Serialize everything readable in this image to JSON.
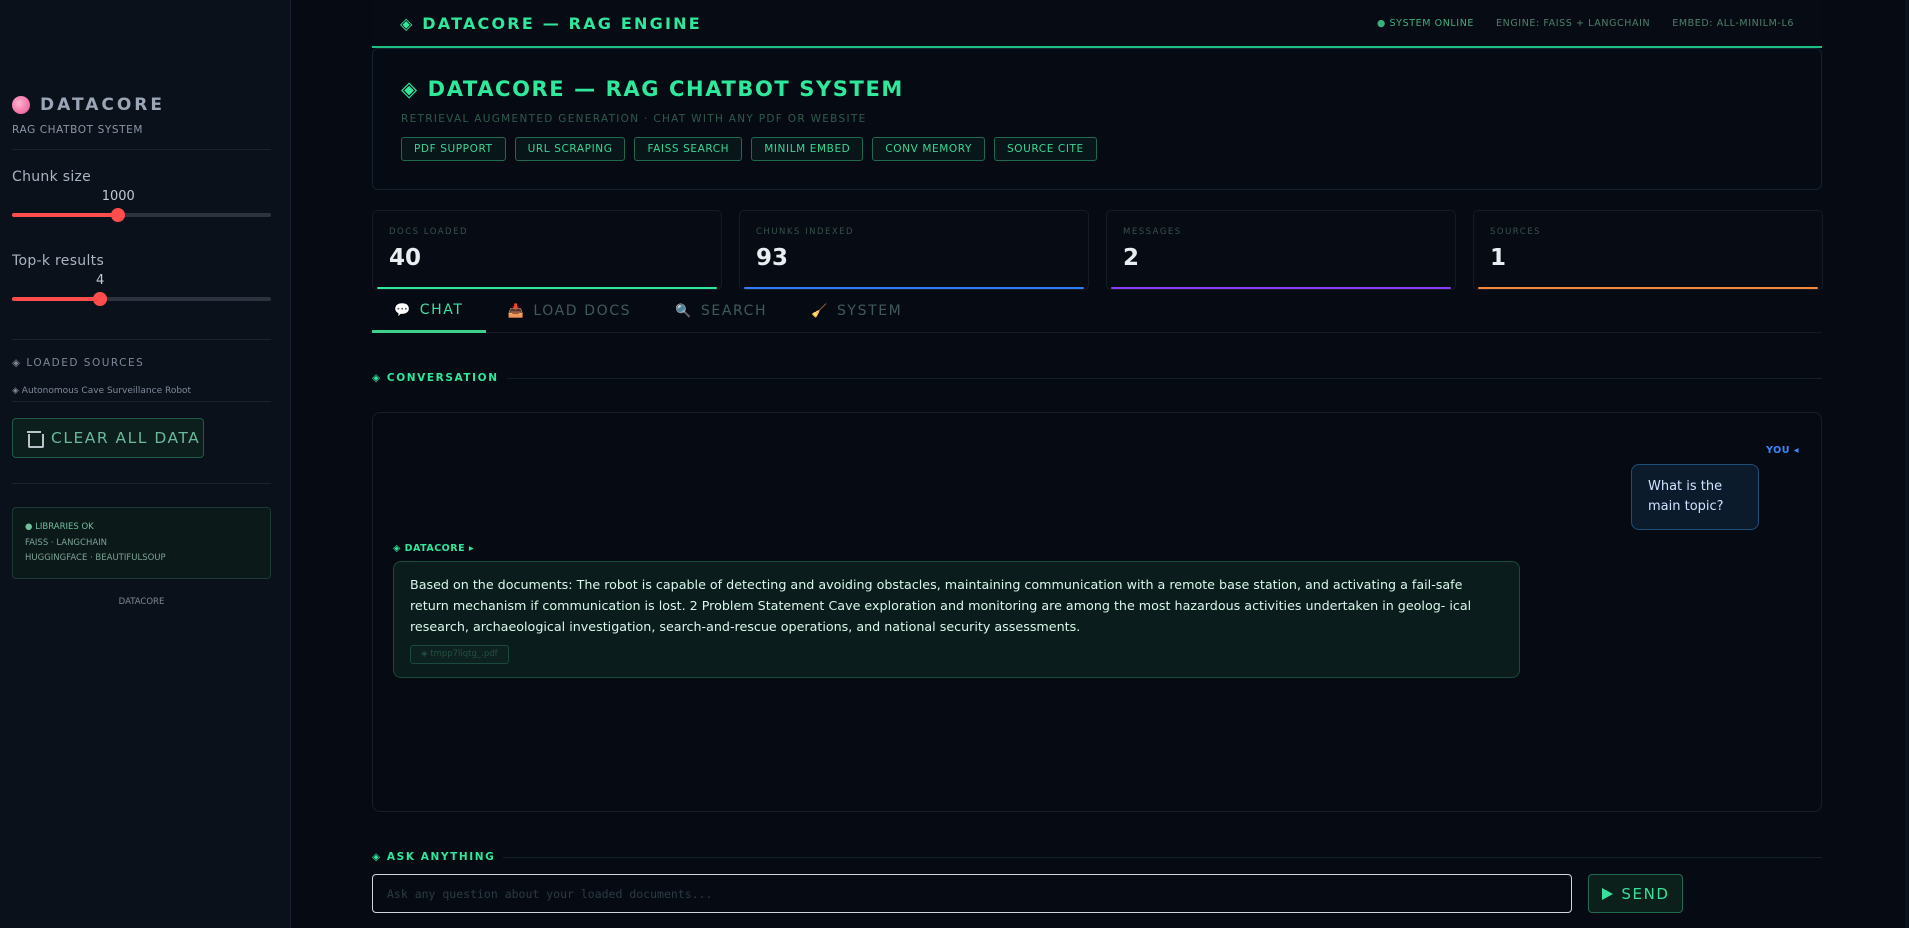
{
  "sidebar": {
    "brand_title": "DATACORE",
    "brand_sub": "RAG CHATBOT SYSTEM",
    "chunk_size": {
      "label": "Chunk size",
      "value": "1000",
      "fraction": 0.41
    },
    "top_k": {
      "label": "Top-k results",
      "value": "4",
      "fraction": 0.34
    },
    "loaded_sources_title": "◈ LOADED SOURCES",
    "sources": [
      "◈ Autonomous Cave Surveillance Robot"
    ],
    "clear_label": "CLEAR ALL DATA",
    "status_ok": "● LIBRARIES OK",
    "status_line2": "FAISS · LANGCHAIN",
    "status_line3": "HUGGINGFACE · BEAUTIFULSOUP",
    "footer": "DATACORE"
  },
  "topbar": {
    "title": "◈ DATACORE — RAG ENGINE",
    "online": "● SYSTEM ONLINE",
    "engine": "ENGINE: FAISS + LANGCHAIN",
    "embed": "EMBED: ALL-MINILM-L6"
  },
  "hero": {
    "title": "◈ DATACORE — RAG CHATBOT SYSTEM",
    "subtitle": "RETRIEVAL AUGMENTED GENERATION · CHAT WITH ANY PDF OR WEBSITE",
    "tags": [
      "PDF SUPPORT",
      "URL SCRAPING",
      "FAISS SEARCH",
      "MINILM EMBED",
      "CONV MEMORY",
      "SOURCE CITE"
    ]
  },
  "stats": [
    {
      "label": "DOCS LOADED",
      "value": "40",
      "color": "#2ee89c"
    },
    {
      "label": "CHUNKS INDEXED",
      "value": "93",
      "color": "#2f7cf6"
    },
    {
      "label": "MESSAGES",
      "value": "2",
      "color": "#8b3cf7"
    },
    {
      "label": "SOURCES",
      "value": "1",
      "color": "#f5883a"
    }
  ],
  "tabs": [
    {
      "icon": "💬",
      "label": "CHAT"
    },
    {
      "icon": "📥",
      "label": "LOAD DOCS"
    },
    {
      "icon": "🔍",
      "label": "SEARCH"
    },
    {
      "icon": "🧹",
      "label": "SYSTEM"
    }
  ],
  "conversation": {
    "section_title": "◈ CONVERSATION",
    "you_label": "YOU ◂",
    "you_text": "What is the main topic?",
    "bot_label": "◈ DATACORE ▸",
    "bot_text": "Based on the documents: The robot is capable of detecting and avoiding obstacles, maintaining communication with a remote base station, and activating a fail-safe return mechanism if communication is lost. 2 Problem Statement Cave exploration and monitoring are among the most hazardous activities undertaken in geolog- ical research, archaeological investigation, search-and-rescue operations, and national security assessments.",
    "source_chip": "◈ tmpp7liqtg_.pdf"
  },
  "ask": {
    "section_title": "◈ ASK ANYTHING",
    "placeholder": "Ask any question about your loaded documents...",
    "send_label": "SEND"
  }
}
